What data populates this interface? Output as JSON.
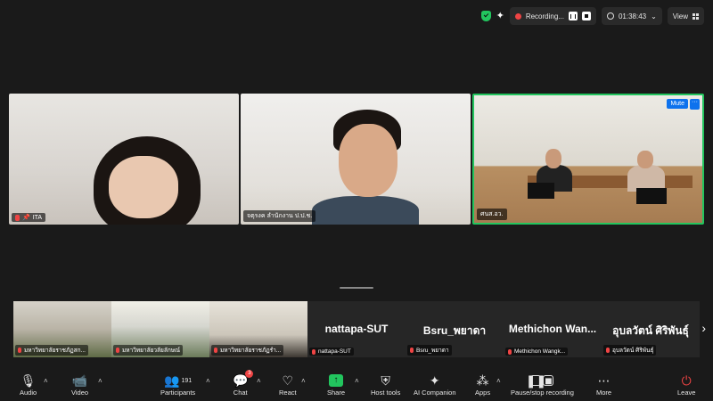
{
  "topbar": {
    "recording_label": "Recording...",
    "timer": "01:38:43",
    "view_label": "View"
  },
  "main_tiles": [
    {
      "name": "ITA"
    },
    {
      "name": "จตุรงค ลำนักงาน ป.ป.ช."
    },
    {
      "name": "ศนส.อว.",
      "mute_label": "Mute",
      "more_label": "···"
    }
  ],
  "gallery": [
    {
      "name": "มหาวิทยาลัยราชภัฏสก..."
    },
    {
      "name": "มหาวิทยาลัยวลัยลักษณ์"
    },
    {
      "name": "มหาวิทยาลัยราชภัฏรำ..."
    },
    {
      "display": "nattapa-SUT",
      "name": "nattapa-SUT"
    },
    {
      "display": "Bsru_พยาดา",
      "name": "Bsru_พยาดา"
    },
    {
      "display": "Methichon Wan...",
      "name": "Methichon Wangk..."
    },
    {
      "display": "อุบลวัตน์ ศิริพันธุ์",
      "name": "อุบลวัตน์ ศิริพันธุ์"
    }
  ],
  "toolbar": {
    "audio": "Audio",
    "video": "Video",
    "participants": "Participants",
    "participants_count": "191",
    "chat": "Chat",
    "chat_badge": "3",
    "react": "React",
    "share": "Share",
    "host_tools": "Host tools",
    "ai_companion": "AI Companion",
    "apps": "Apps",
    "pause_stop_recording": "Pause/stop recording",
    "more": "More",
    "leave": "Leave"
  },
  "colors": {
    "active_speaker_border": "#22c55e",
    "mute_button": "#0e72ed",
    "leave": "#ef4444",
    "share": "#22c55e"
  }
}
